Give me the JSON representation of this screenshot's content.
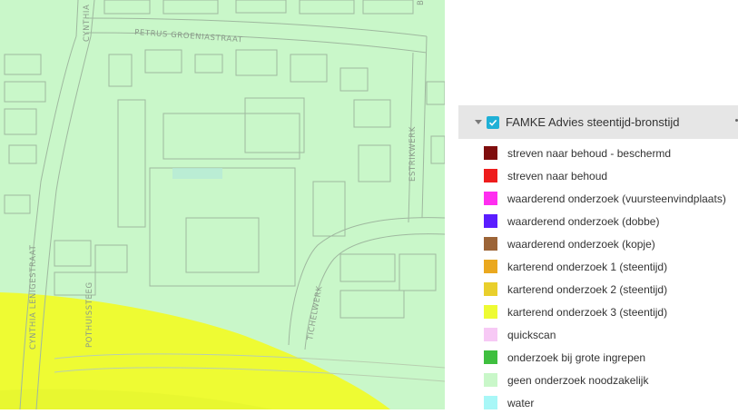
{
  "map": {
    "base_color": "#c9f7c9",
    "zone_color": "#eefb33",
    "street_labels": {
      "petrus": "PETRUS GROENIASTRAAT",
      "cynthia_top": "CYNTHIA",
      "cynthia_lenige": "CYNTHIA LENIGESTRAAT",
      "pothuissteeg": "POTHUISSTEEG",
      "tichelwerk": "TICHELWERK",
      "estrikwerk": "ESTRIKWERK",
      "top_right": "B"
    }
  },
  "legend_panel": {
    "layer_title": "FAMKE Advies steentijd-bronstijd",
    "layer_checked": true,
    "items": [
      {
        "label": "streven naar behoud - beschermd",
        "color": "#7f0d0d"
      },
      {
        "label": "streven naar behoud",
        "color": "#ee1c1c"
      },
      {
        "label": "waarderend onderzoek (vuursteenvindplaats)",
        "color": "#ff2ef0"
      },
      {
        "label": "waarderend onderzoek (dobbe)",
        "color": "#5a1dff"
      },
      {
        "label": "waarderend onderzoek (kopje)",
        "color": "#9c6437"
      },
      {
        "label": "karterend onderzoek 1 (steentijd)",
        "color": "#eaa81f"
      },
      {
        "label": "karterend onderzoek 2 (steentijd)",
        "color": "#e9cf2c"
      },
      {
        "label": "karterend onderzoek 3 (steentijd)",
        "color": "#eefb33"
      },
      {
        "label": "quickscan",
        "color": "#f7c9f5"
      },
      {
        "label": "onderzoek bij grote ingrepen",
        "color": "#3fbf3f"
      },
      {
        "label": "geen onderzoek noodzakelijk",
        "color": "#c9f7c9"
      },
      {
        "label": "water",
        "color": "#a8f7f7"
      }
    ]
  }
}
